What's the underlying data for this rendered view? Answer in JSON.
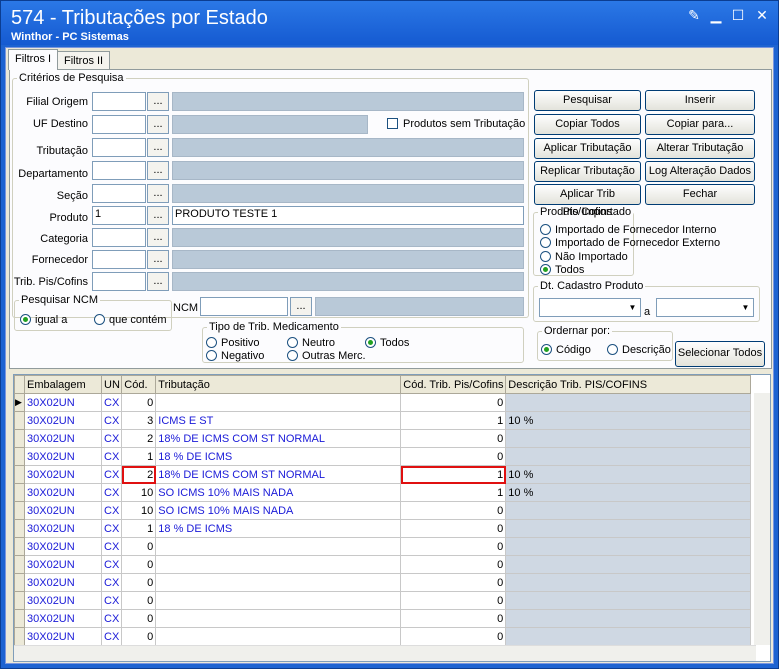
{
  "window": {
    "title": "574 - Tributações por Estado",
    "subtitle": "Winthor - PC Sistemas"
  },
  "tabs": [
    "Filtros I",
    "Filtros II"
  ],
  "criterios": {
    "legend": "Critérios de Pesquisa"
  },
  "fields": {
    "filial": {
      "label": "Filial Origem",
      "value": ""
    },
    "uf": {
      "label": "UF Destino",
      "value": ""
    },
    "tributacao": {
      "label": "Tributação",
      "value": ""
    },
    "departamento": {
      "label": "Departamento",
      "value": ""
    },
    "secao": {
      "label": "Seção",
      "value": ""
    },
    "produto": {
      "label": "Produto",
      "value": "1",
      "desc": "PRODUTO TESTE 1"
    },
    "categoria": {
      "label": "Categoria",
      "value": ""
    },
    "fornecedor": {
      "label": "Fornecedor",
      "value": ""
    },
    "trib_pis": {
      "label": "Trib. Pis/Cofins",
      "value": ""
    },
    "ncm": {
      "label": "NCM",
      "value": ""
    }
  },
  "dots": "...",
  "sem_trib": "Produtos sem Tributação",
  "pesquisar_ncm": {
    "legend": "Pesquisar NCM",
    "igual": "igual a",
    "contem": "que contém"
  },
  "medicamento": {
    "legend": "Tipo de Trib. Medicamento",
    "positivo": "Positivo",
    "negativo": "Negativo",
    "neutro": "Neutro",
    "outras": "Outras Merc.",
    "todos": "Todos"
  },
  "buttons": {
    "pesquisar": "Pesquisar",
    "inserir": "Inserir",
    "copiar_todos": "Copiar Todos",
    "copiar_para": "Copiar para...",
    "aplicar": "Aplicar Tributação",
    "alterar": "Alterar Tributação",
    "replicar": "Replicar Tributação",
    "log": "Log Alteração Dados",
    "aplicar_pis": "Aplicar Trib Pis/Cofins",
    "fechar": "Fechar",
    "selecionar": "Selecionar Todos"
  },
  "importado": {
    "legend": "Produto Importado",
    "interno": "Importado de Fornecedor Interno",
    "externo": "Importado de Fornecedor Externo",
    "nao": "Não Importado",
    "todos": "Todos"
  },
  "dt_cadastro": {
    "legend": "Dt. Cadastro Produto",
    "a": "a"
  },
  "ordenar": {
    "legend": "Ordernar por:",
    "codigo": "Código",
    "descricao": "Descrição"
  },
  "grid": {
    "headers": [
      "Embalagem",
      "UN",
      "Cód.",
      "Tributação",
      "Cód. Trib. Pis/Cofins",
      "Descrição Trib. PIS/COFINS"
    ],
    "rows": [
      [
        "30X02UN",
        "CX",
        "0",
        "",
        "0",
        ""
      ],
      [
        "30X02UN",
        "CX",
        "3",
        "ICMS E ST",
        "1",
        "10 %"
      ],
      [
        "30X02UN",
        "CX",
        "2",
        "18% DE ICMS COM ST NORMAL",
        "0",
        ""
      ],
      [
        "30X02UN",
        "CX",
        "1",
        "18 % DE ICMS",
        "0",
        ""
      ],
      [
        "30X02UN",
        "CX",
        "2",
        "18% DE ICMS COM ST NORMAL",
        "1",
        "10 %"
      ],
      [
        "30X02UN",
        "CX",
        "10",
        "SO ICMS 10% MAIS NADA",
        "1",
        "10 %"
      ],
      [
        "30X02UN",
        "CX",
        "10",
        "SO ICMS 10% MAIS NADA",
        "0",
        ""
      ],
      [
        "30X02UN",
        "CX",
        "1",
        "18 % DE ICMS",
        "0",
        ""
      ],
      [
        "30X02UN",
        "CX",
        "0",
        "",
        "0",
        ""
      ],
      [
        "30X02UN",
        "CX",
        "0",
        "",
        "0",
        ""
      ],
      [
        "30X02UN",
        "CX",
        "0",
        "",
        "0",
        ""
      ],
      [
        "30X02UN",
        "CX",
        "0",
        "",
        "0",
        ""
      ],
      [
        "30X02UN",
        "CX",
        "0",
        "",
        "0",
        ""
      ],
      [
        "30X02UN",
        "CX",
        "0",
        "",
        "0",
        ""
      ]
    ]
  }
}
